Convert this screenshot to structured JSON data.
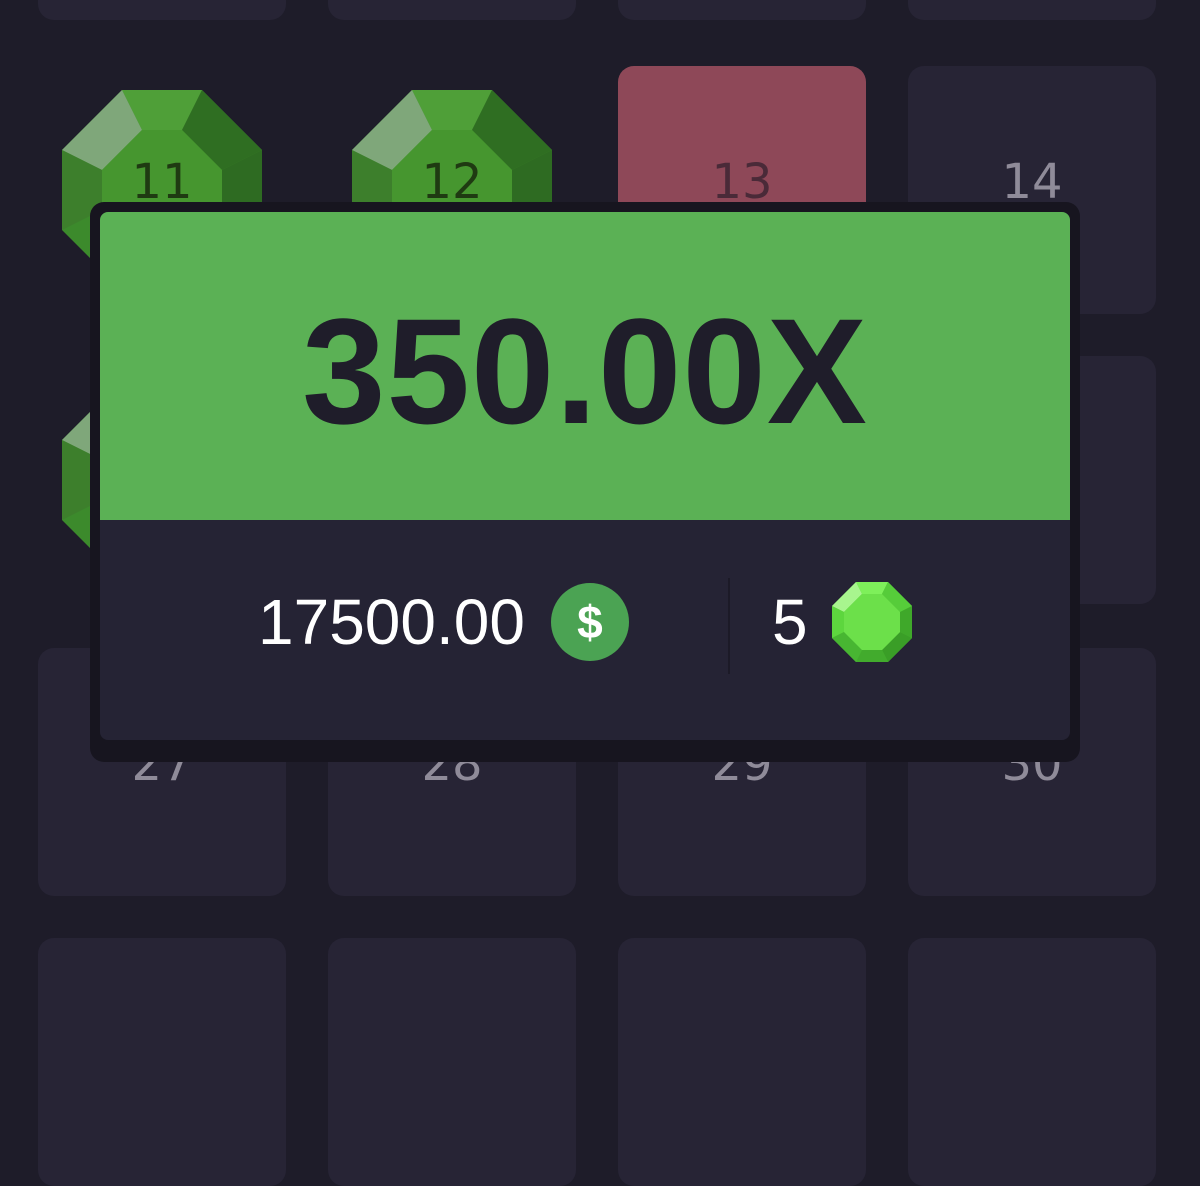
{
  "grid": {
    "tiles": [
      {
        "number": "11",
        "state": "gem"
      },
      {
        "number": "12",
        "state": "gem"
      },
      {
        "number": "13",
        "state": "mine"
      },
      {
        "number": "14",
        "state": "hidden"
      },
      {
        "number": "27",
        "state": "hidden"
      },
      {
        "number": "28",
        "state": "hidden"
      },
      {
        "number": "29",
        "state": "hidden"
      },
      {
        "number": "30",
        "state": "hidden"
      }
    ]
  },
  "result": {
    "multiplier": "350.00X",
    "payout": "17500.00",
    "currency_symbol": "$",
    "gems_found": "5"
  },
  "colors": {
    "background": "#1e1c29",
    "tile": "#272435",
    "mine_tile": "#8e4858",
    "win_banner": "#5bb155",
    "gem_dark": "#3a7d2a",
    "gem_light": "#6ce04a"
  }
}
